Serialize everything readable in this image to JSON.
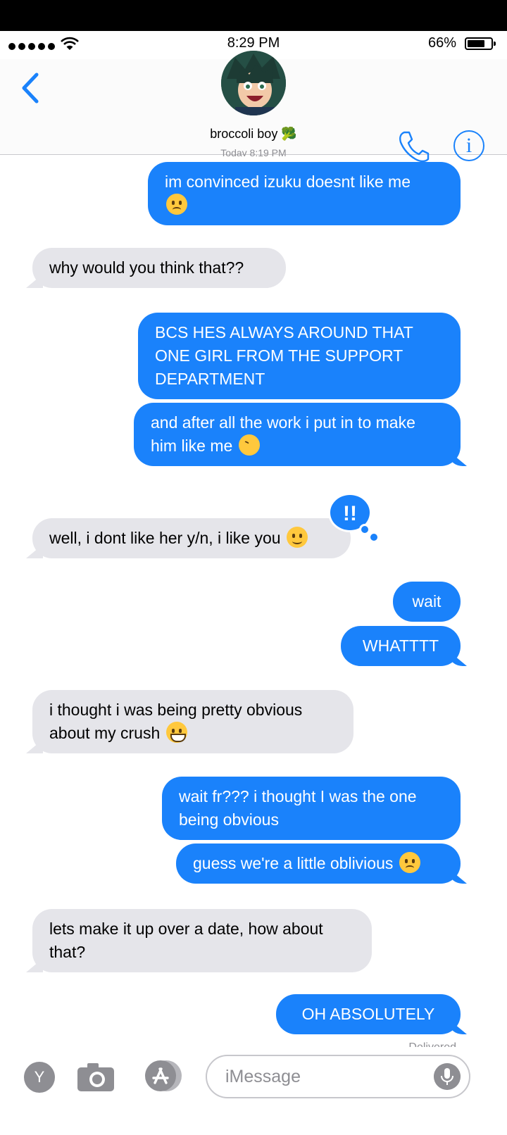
{
  "status": {
    "time": "8:29 PM",
    "battery": "66%"
  },
  "header": {
    "contact_name": "broccoli boy 🥦"
  },
  "messages": [
    {
      "side": "out",
      "text": "im convinced izuku doesnt like me"
    },
    {
      "side": "in",
      "text": "why would you think that??"
    },
    {
      "side": "out",
      "text": "BCS HES ALWAYS AROUND THAT ONE GIRL FROM THE SUPPORT DEPARTMENT"
    },
    {
      "side": "out",
      "text": "and after all the work i put in to make him like me"
    },
    {
      "side": "in",
      "text": "well, i dont like her y/n, i like you"
    },
    {
      "side": "out",
      "text": "wait"
    },
    {
      "side": "out",
      "text": "WHATTTT"
    },
    {
      "side": "in",
      "text": "i thought i was being pretty obvious about my crush"
    },
    {
      "side": "out",
      "text": "wait fr??? i thought I was the one being obvious"
    },
    {
      "side": "out",
      "text": "guess we're a little oblivious"
    },
    {
      "side": "in",
      "text": "lets make it up over a date, how about that?"
    },
    {
      "side": "out",
      "text": "OH ABSOLUTELY"
    }
  ],
  "reaction": {
    "label": "!!",
    "color": "#1a82fb"
  },
  "delivered": "Delivered",
  "input": {
    "placeholder": "iMessage"
  },
  "app_button": {
    "label": "Y"
  },
  "colors": {
    "accent": "#1a82fb",
    "incoming": "#e5e5ea"
  }
}
